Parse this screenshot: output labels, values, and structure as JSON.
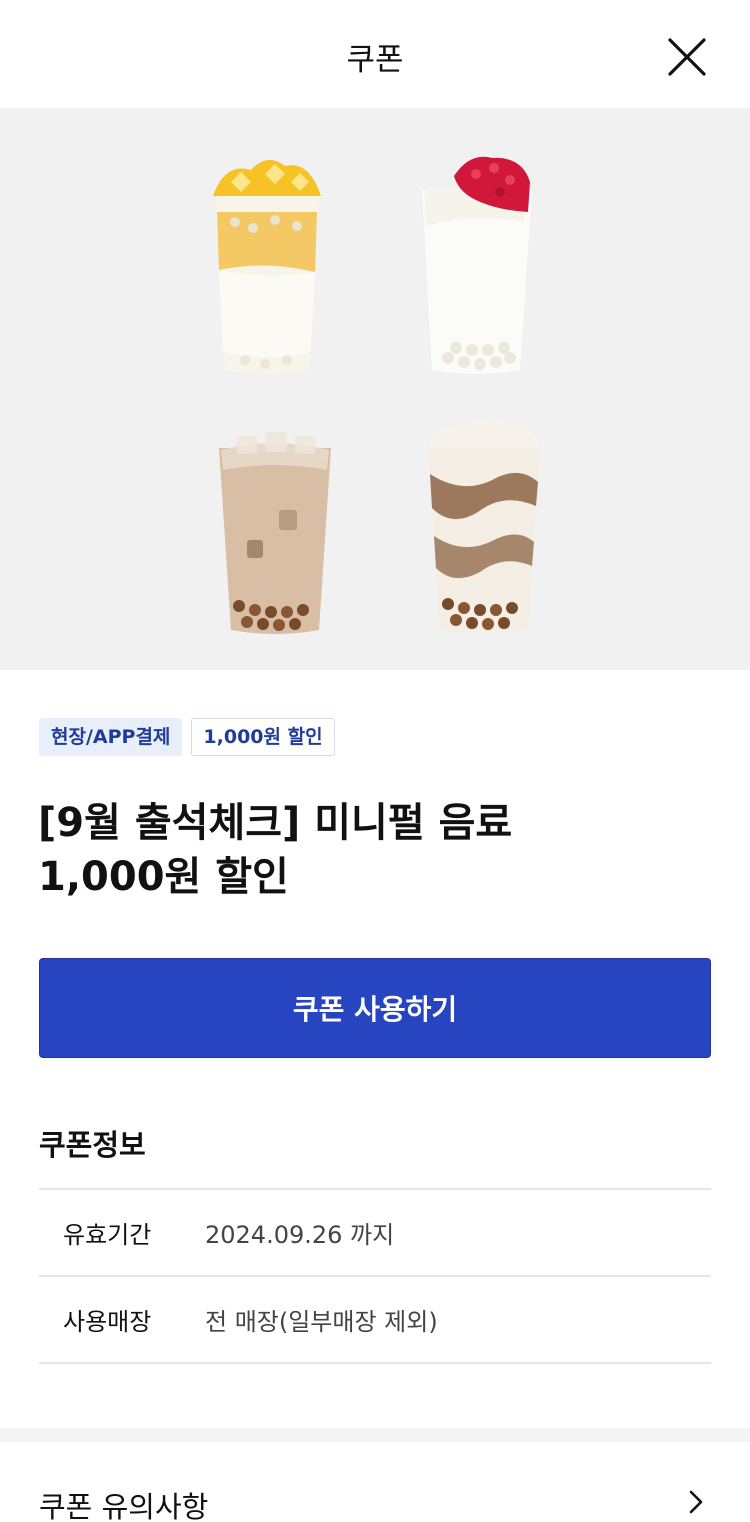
{
  "header": {
    "title": "쿠폰",
    "close_icon": "close-icon"
  },
  "hero": {
    "drinks": [
      "mango-drink-icon",
      "strawberry-milk-drink-icon",
      "milk-tea-drink-icon",
      "brown-sugar-foam-drink-icon"
    ]
  },
  "tags": [
    {
      "label": "현장/APP결제"
    },
    {
      "label": "1,000원 할인"
    }
  ],
  "coupon": {
    "title_line1": "[9월 출석체크] 미니펄 음료",
    "title_line2": "1,000원 할인"
  },
  "use_button": {
    "label": "쿠폰 사용하기"
  },
  "info": {
    "section_title": "쿠폰정보",
    "rows": [
      {
        "label": "유효기간",
        "value": "2024.09.26 까지"
      },
      {
        "label": "사용매장",
        "value": "전 매장(일부매장 제외)"
      }
    ]
  },
  "notice": {
    "label": "쿠폰 유의사항",
    "chevron_icon": "chevron-right-icon"
  },
  "colors": {
    "primary": "#2744c1",
    "tag_text": "#1f3c9a",
    "tag_bg": "#e9eefb",
    "hero_bg": "#f1f1f1"
  }
}
